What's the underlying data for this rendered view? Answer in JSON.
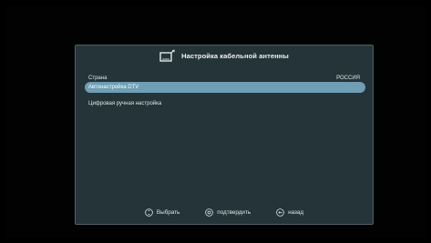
{
  "dialog": {
    "title": "Настройка кабельной антенны",
    "title_icon": "tv-setup-icon"
  },
  "country": {
    "label": "Страна",
    "value": "РОССИЯ"
  },
  "menu": {
    "items": [
      {
        "label": "Автонастройка DTV",
        "selected": true
      },
      {
        "label": "Цифровая ручная настройка",
        "selected": false
      }
    ]
  },
  "footer": {
    "hints": [
      {
        "label": "Выбрать",
        "icon": "navigate-icon"
      },
      {
        "label": "подтвердить",
        "icon": "ok-icon"
      },
      {
        "label": "назад",
        "icon": "back-icon"
      }
    ]
  },
  "colors": {
    "background": "#000000",
    "dialog": "#243439",
    "dialog_border": "#4f6166",
    "selection": "#6f9eb5",
    "text": "#dfe6e8"
  }
}
